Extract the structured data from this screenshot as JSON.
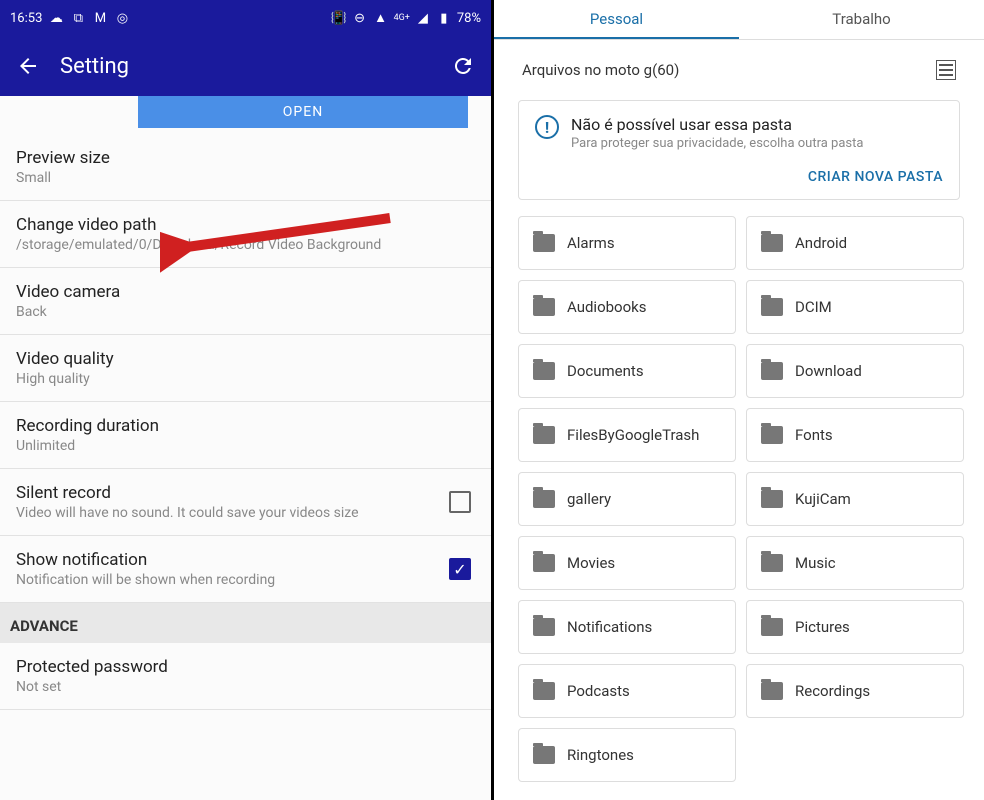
{
  "left": {
    "status": {
      "time": "16:53",
      "battery": "78%",
      "net": "4G+"
    },
    "appbar": {
      "title": "Setting"
    },
    "open_button": "OPEN",
    "items": [
      {
        "title": "Preview size",
        "sub": "Small"
      },
      {
        "title": "Change video path",
        "sub": "/storage/emulated/0/Download/Record Video Background"
      },
      {
        "title": "Video camera",
        "sub": "Back"
      },
      {
        "title": "Video quality",
        "sub": "High quality"
      },
      {
        "title": "Recording duration",
        "sub": "Unlimited"
      },
      {
        "title": "Silent record",
        "sub": "Video will have no sound. It could save your videos size"
      },
      {
        "title": "Show notification",
        "sub": "Notification will be shown when recording"
      }
    ],
    "advance_header": "ADVANCE",
    "protected": {
      "title": "Protected password",
      "sub": "Not set"
    }
  },
  "right": {
    "tabs": {
      "personal": "Pessoal",
      "work": "Trabalho"
    },
    "location": "Arquivos no moto g(60)",
    "info": {
      "title": "Não é possível usar essa pasta",
      "sub": "Para proteger sua privacidade, escolha outra pasta",
      "action": "CRIAR NOVA PASTA"
    },
    "folders": [
      "Alarms",
      "Android",
      "Audiobooks",
      "DCIM",
      "Documents",
      "Download",
      "FilesByGoogleTrash",
      "Fonts",
      "gallery",
      "KujiCam",
      "Movies",
      "Music",
      "Notifications",
      "Pictures",
      "Podcasts",
      "Recordings",
      "Ringtones"
    ]
  }
}
